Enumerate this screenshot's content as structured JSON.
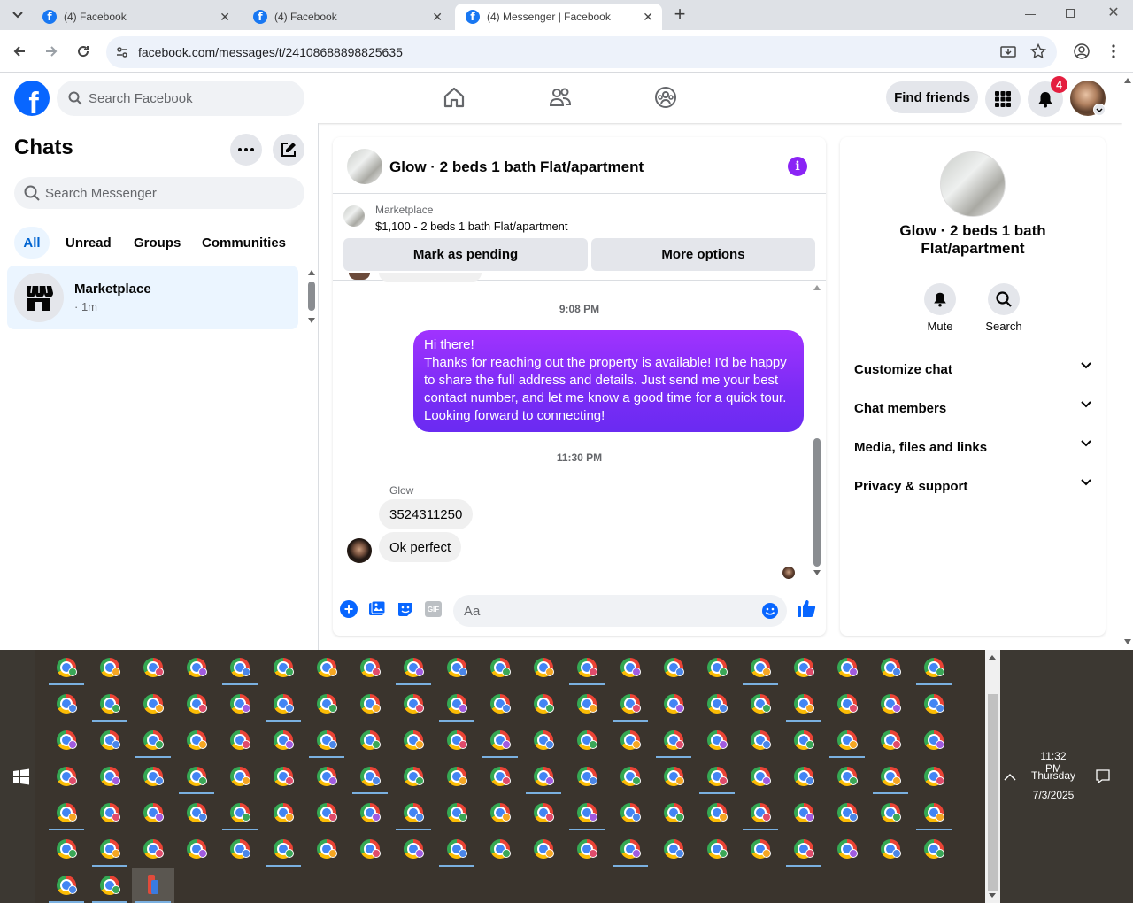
{
  "browser": {
    "tabs": [
      {
        "title": "(4) Facebook",
        "active": false
      },
      {
        "title": "(4) Facebook",
        "active": false
      },
      {
        "title": "(4) Messenger | Facebook",
        "active": true
      }
    ],
    "url": "facebook.com/messages/t/24108688898825635"
  },
  "fb": {
    "search_placeholder": "Search Facebook",
    "find_friends": "Find friends",
    "notification_count": "4"
  },
  "chats": {
    "title": "Chats",
    "search_placeholder": "Search Messenger",
    "filters": [
      "All",
      "Unread",
      "Groups",
      "Communities"
    ],
    "items": [
      {
        "name": "Marketplace",
        "preview": "· 1m"
      }
    ]
  },
  "conversation": {
    "title": "Glow · 2 beds 1 bath Flat/apartment",
    "listing": {
      "source": "Marketplace",
      "summary": "$1,100 - 2 beds 1 bath Flat/apartment",
      "mark_pending": "Mark as pending",
      "more_options": "More options"
    },
    "messages": [
      {
        "time": "9:08 PM"
      },
      {
        "from": "me",
        "lines": [
          "Hi there!",
          "Thanks for reaching out the property is available! I'd be happy",
          "to share the full address and details. Just send me your best",
          "contact number, and let me know a good time for a quick tour.",
          "Looking forward to connecting!"
        ]
      },
      {
        "time": "11:30 PM"
      },
      {
        "sender": "Glow",
        "text": "3524311250"
      },
      {
        "sender": "Glow",
        "text": "Ok perfect"
      }
    ],
    "composer_placeholder": "Aa"
  },
  "info_panel": {
    "name": "Glow · 2 beds 1 bath Flat/apartment",
    "actions": [
      "Mute",
      "Search"
    ],
    "sections": [
      "Customize chat",
      "Chat members",
      "Media, files and links",
      "Privacy & support"
    ]
  },
  "taskbar": {
    "time": "11:32 PM",
    "day": "Thursday",
    "date": "7/3/2025"
  },
  "colors": {
    "fb_blue": "#0866ff",
    "messenger_purple": "#7b2cf5",
    "badge_red": "#e41e3f",
    "selected_chat_bg": "#ebf5ff"
  }
}
